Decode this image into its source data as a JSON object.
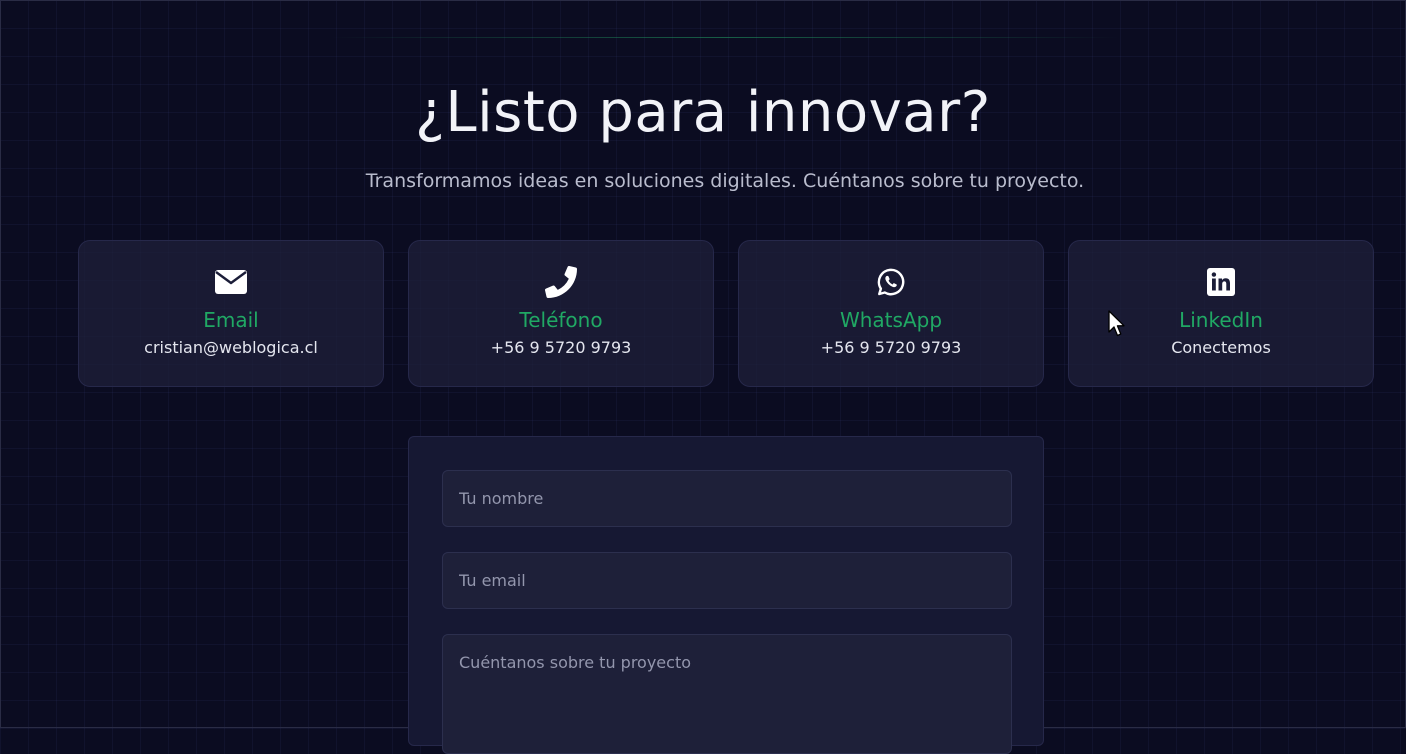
{
  "hero": {
    "title": "¿Listo para innovar?",
    "subtitle": "Transformamos ideas en soluciones digitales. Cuéntanos sobre tu proyecto."
  },
  "contact_cards": [
    {
      "icon": "envelope-icon",
      "label": "Email",
      "value": "cristian@weblogica.cl"
    },
    {
      "icon": "phone-icon",
      "label": "Teléfono",
      "value": "+56 9 5720 9793"
    },
    {
      "icon": "whatsapp-icon",
      "label": "WhatsApp",
      "value": "+56 9 5720 9793"
    },
    {
      "icon": "linkedin-icon",
      "label": "LinkedIn",
      "value": "Conectemos"
    }
  ],
  "form": {
    "name_placeholder": "Tu nombre",
    "email_placeholder": "Tu email",
    "message_placeholder": "Cuéntanos sobre tu proyecto"
  },
  "colors": {
    "background": "#0b0c21",
    "accent": "#20a864",
    "card_background": "#1b1d38",
    "text_primary": "#f2f3f8",
    "text_secondary": "#b9bccd"
  }
}
